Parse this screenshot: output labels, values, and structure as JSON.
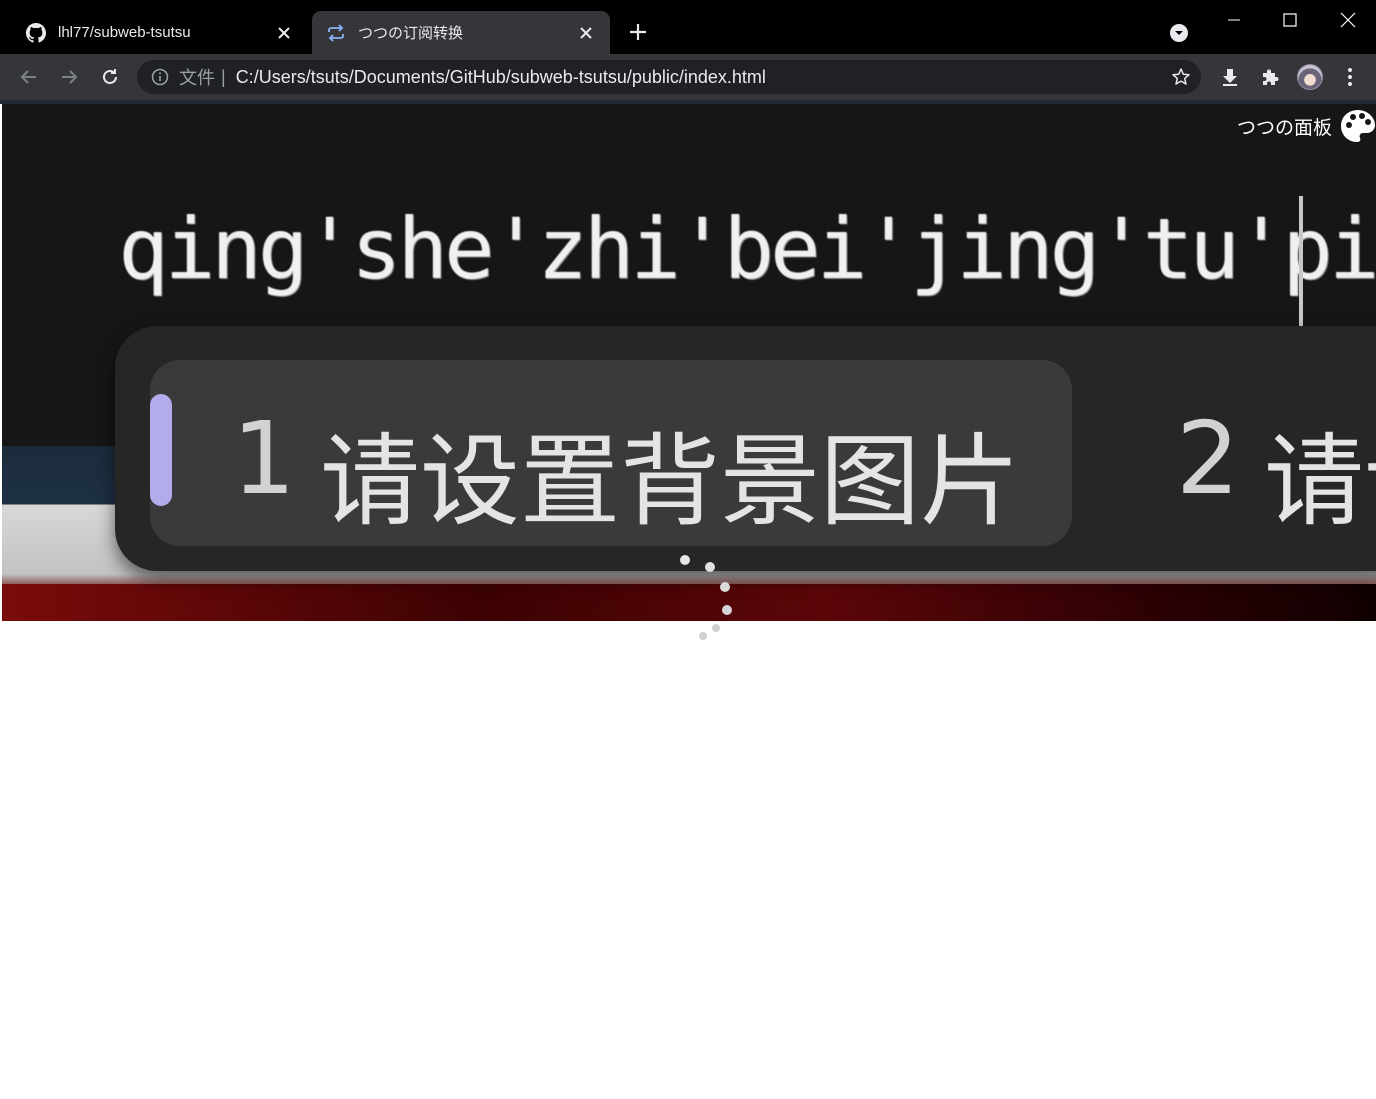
{
  "browser": {
    "tabs": [
      {
        "title": "lhl77/subweb-tsutsu",
        "favicon": "github-icon",
        "active": false
      },
      {
        "title": "つつの订阅转换",
        "favicon": "repeat-icon",
        "active": true
      }
    ],
    "address_bar": {
      "security_chip": "文件",
      "separator": "|",
      "url": "C:/Users/tsuts/Documents/GitHub/subweb-tsutsu/public/index.html"
    },
    "colors": {
      "tabstrip": "#000000",
      "toolbar": "#35363a",
      "omnibox": "#202124",
      "text": "#e8eaed"
    }
  },
  "page": {
    "panel_title": "つつの面板",
    "panel_icon": "palette-icon",
    "background_image": {
      "pinyin_text": "qing'she'zhi'bei'jing'tu'pian",
      "candidates": [
        {
          "number": "1",
          "text": "请设置背景图片"
        },
        {
          "number": "2",
          "text": "请设"
        }
      ],
      "accent_color": "#b3acec"
    },
    "loading_indicator": "spinner"
  }
}
